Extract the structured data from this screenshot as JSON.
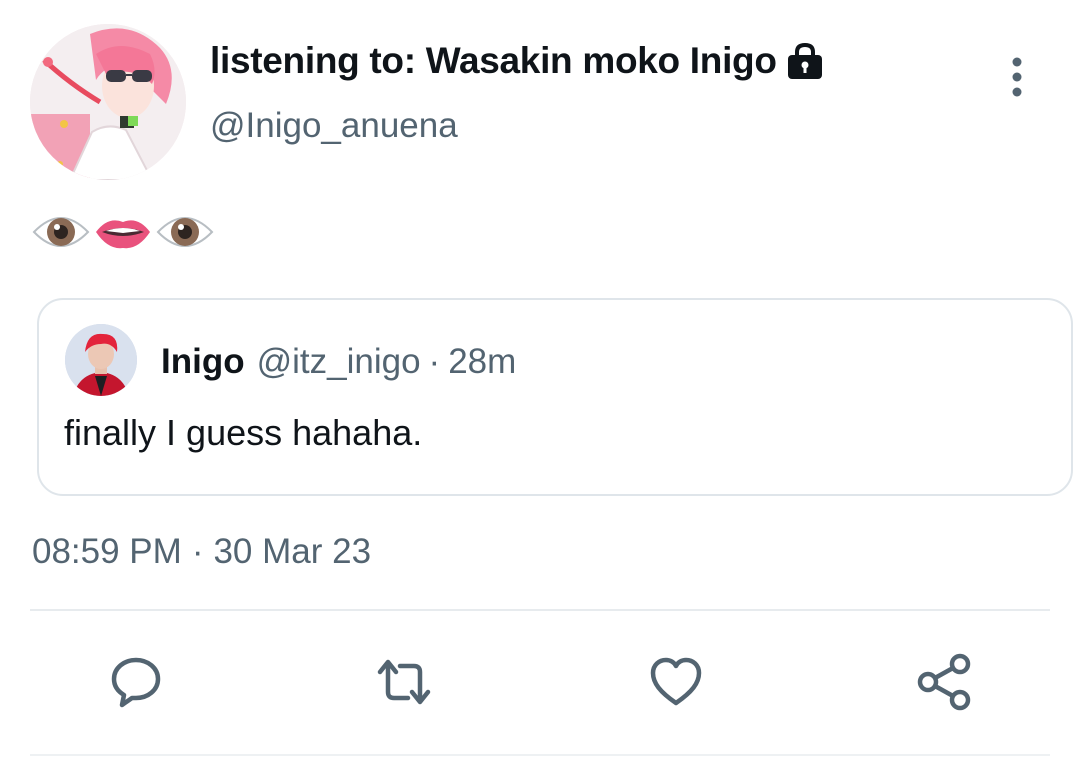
{
  "author": {
    "display_name": "listening to: Wasakin moko Inigo",
    "handle": "@Inigo_anuena",
    "avatar_icon": "avatar-illustration",
    "lock_icon": "lock-icon"
  },
  "tweet": {
    "text_emoji": [
      "👁",
      "👄",
      "👁"
    ],
    "timestamp_time": "08:59 PM",
    "timestamp_separator": "·",
    "timestamp_date": "30 Mar 23"
  },
  "quoted": {
    "name": "Inigo",
    "handle": "@itz_inigo",
    "separator": "·",
    "time": "28m",
    "text": "finally I guess hahaha."
  },
  "actions": [
    "reply-icon",
    "retweet-icon",
    "like-icon",
    "share-icon"
  ],
  "colors": {
    "text_primary": "#0f1419",
    "text_secondary": "#536471",
    "border": "#dfe5ea",
    "icon": "#536471"
  }
}
